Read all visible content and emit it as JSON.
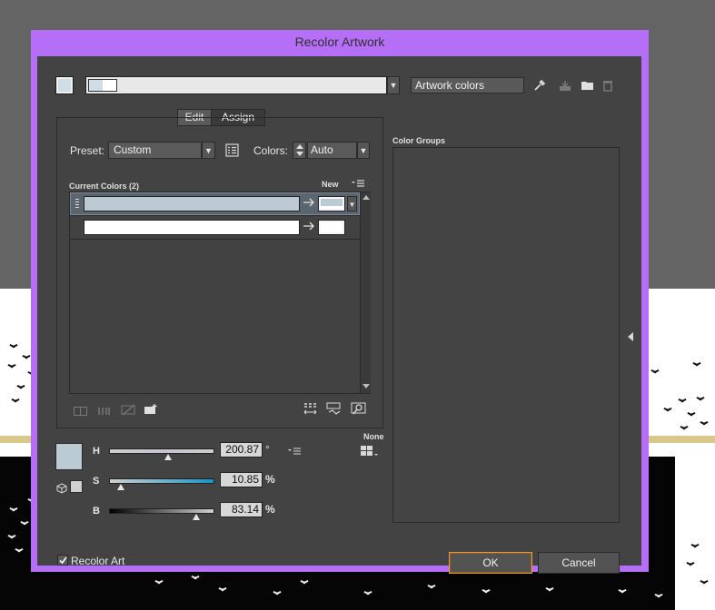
{
  "dialog": {
    "title": "Recolor Artwork"
  },
  "top": {
    "group_name_placeholder": "Artwork colors"
  },
  "tabs": [
    {
      "label": "Edit"
    },
    {
      "label": "Assign"
    }
  ],
  "preset": {
    "label": "Preset:",
    "value": "Custom"
  },
  "colors": {
    "label": "Colors:",
    "value": "Auto"
  },
  "current_colors": {
    "header": "Current Colors (2)",
    "new_header": "New",
    "rows": [
      {
        "current": "#bccbd3",
        "new": "#bccbd3",
        "selected": true
      },
      {
        "current": "#ffffff",
        "new": "#ffffff",
        "selected": false
      }
    ]
  },
  "sliders": {
    "color": "#bccbd3",
    "h": {
      "label": "H",
      "value": "200.87",
      "unit": "°",
      "fraction": 0.558
    },
    "s": {
      "label": "S",
      "value": "10.85",
      "unit": "%",
      "fraction": 0.1085
    },
    "b": {
      "label": "B",
      "value": "83.14",
      "unit": "%",
      "fraction": 0.8314
    }
  },
  "none_label": "None",
  "color_groups": {
    "label": "Color Groups"
  },
  "recolor_art": {
    "label": "Recolor Art",
    "checked": true
  },
  "buttons": {
    "ok": "OK",
    "cancel": "Cancel"
  },
  "colors_theme": {
    "titlebar": "#b56ff7",
    "panel": "#434343",
    "accent_ok": "#e79a3a"
  }
}
